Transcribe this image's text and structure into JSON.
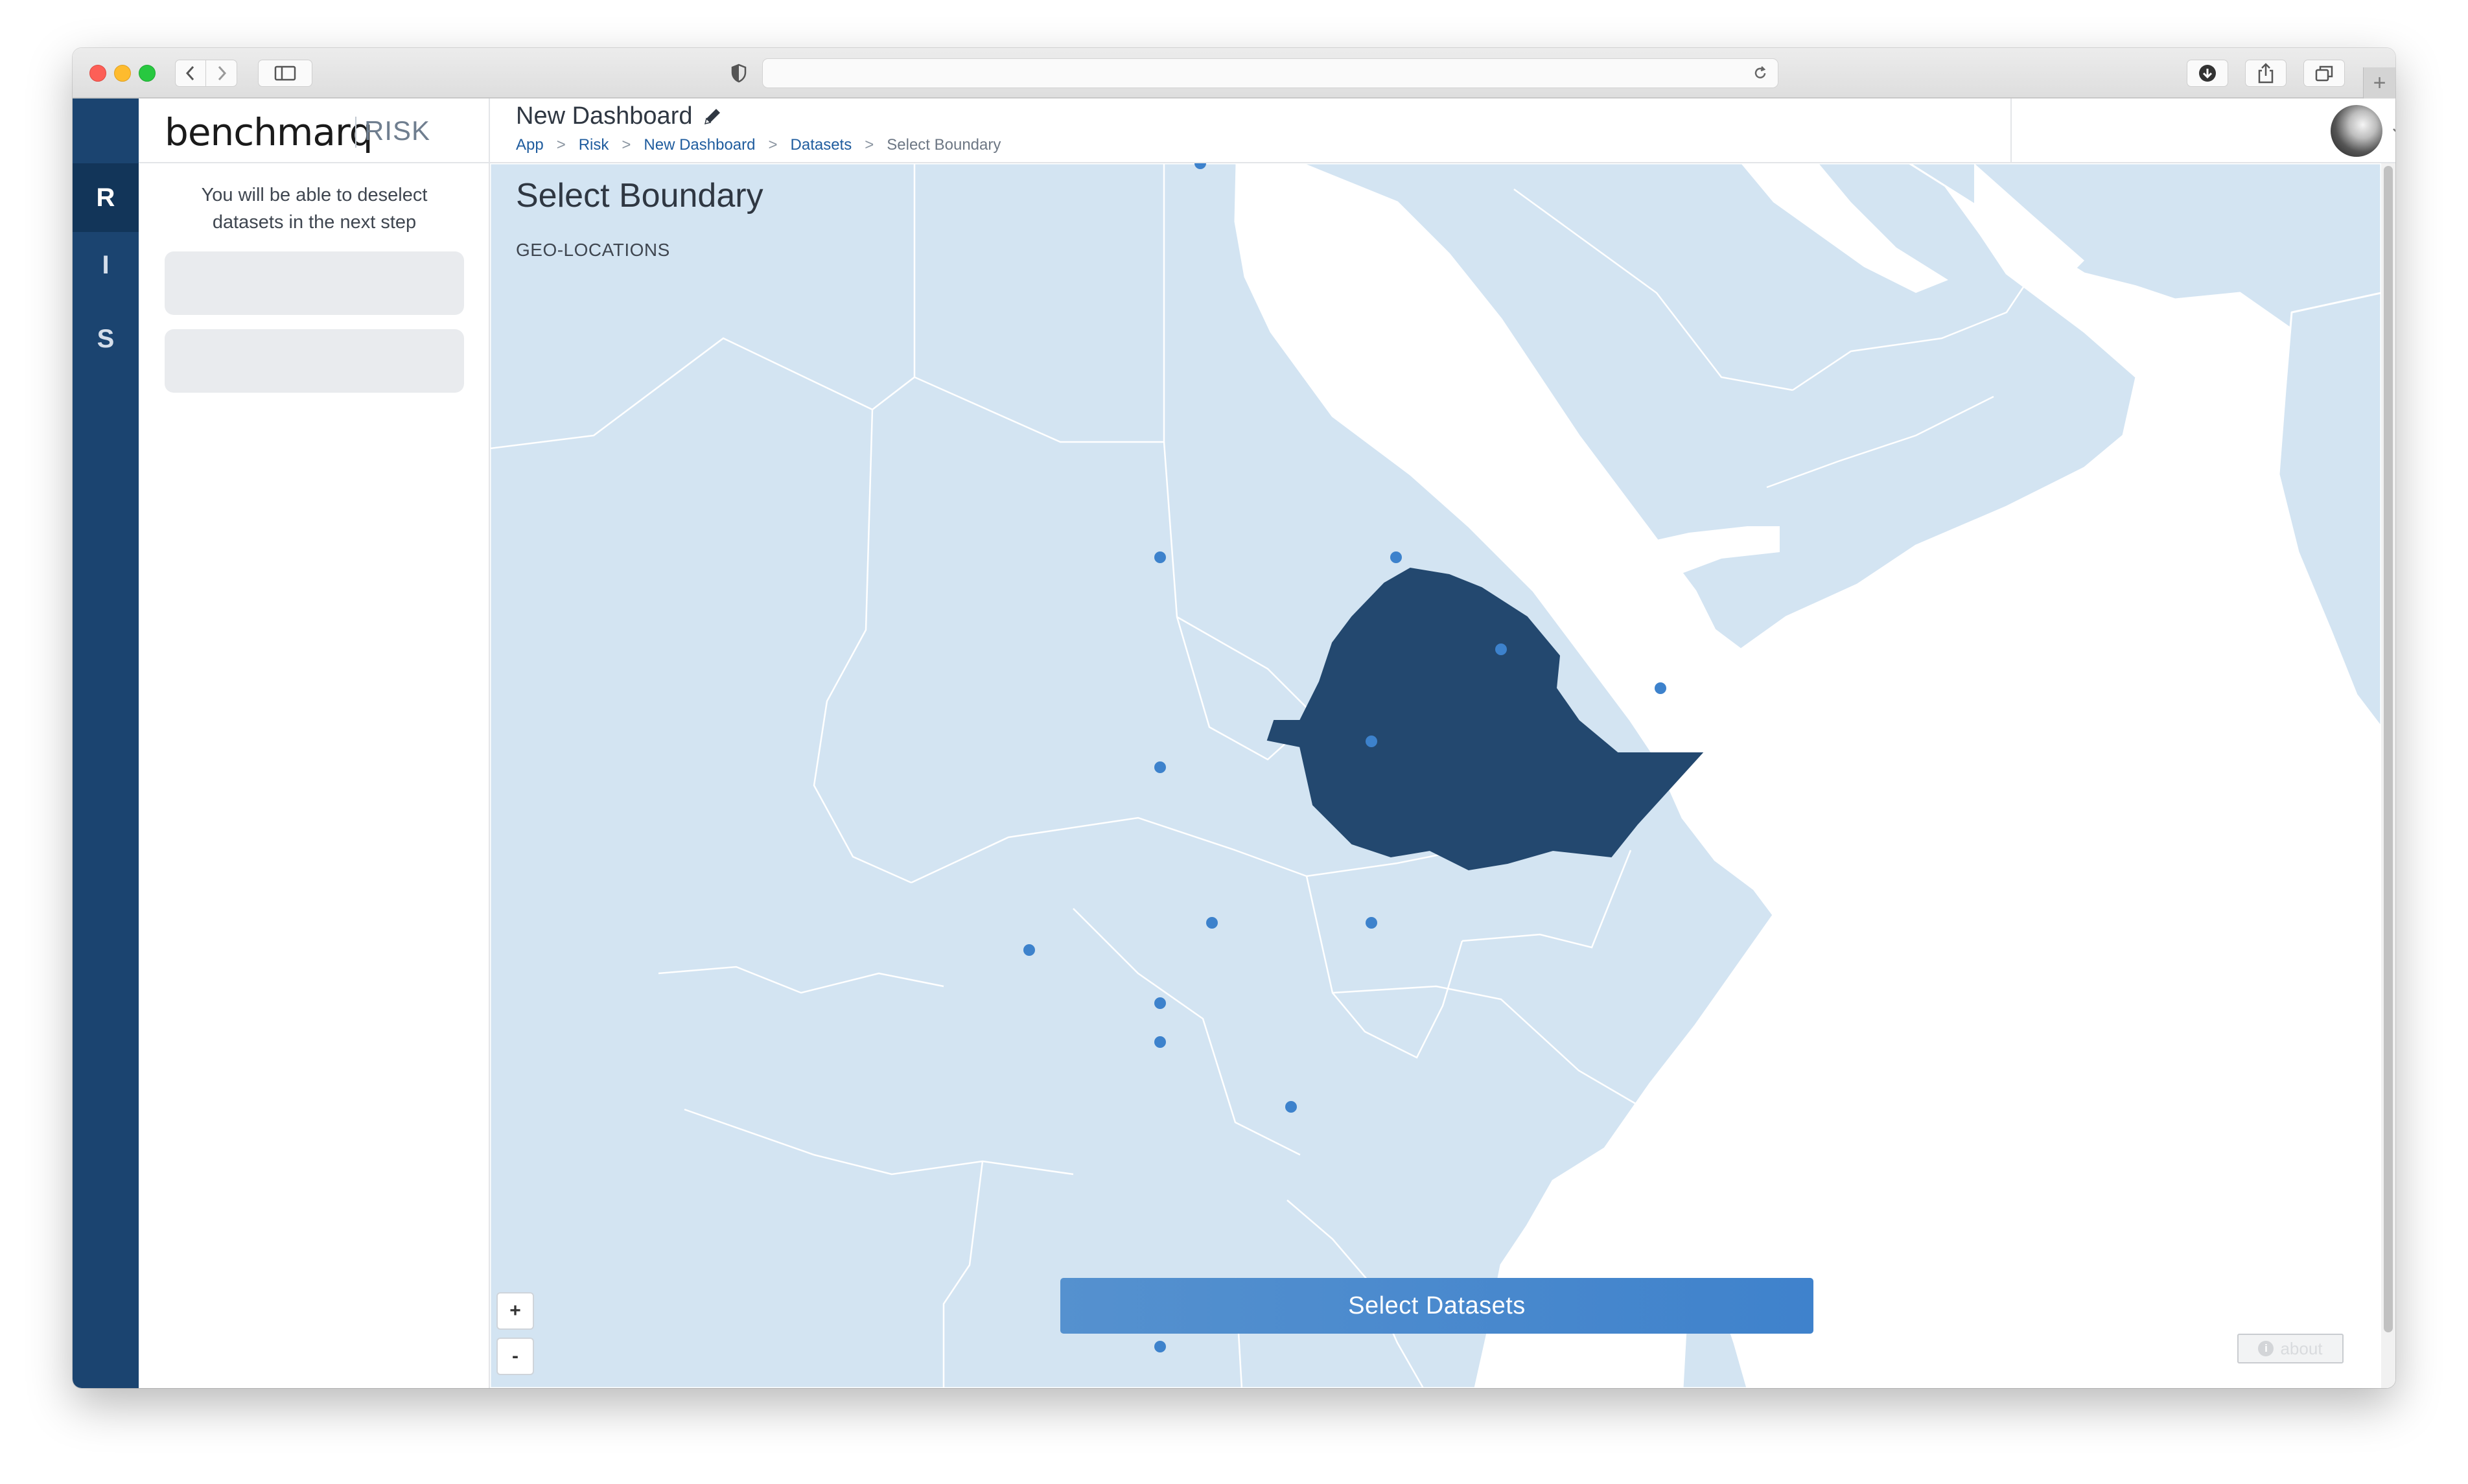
{
  "browser": {
    "address": "",
    "icons": [
      "back-icon",
      "forward-icon",
      "sidebar-icon",
      "shield-icon",
      "reload-icon",
      "download-icon",
      "share-icon",
      "tabs-icon",
      "plus-icon"
    ],
    "new_tab_glyph": "+"
  },
  "rail": {
    "items": [
      {
        "label": "R",
        "active": true
      },
      {
        "label": "I",
        "active": false
      },
      {
        "label": "S",
        "active": false
      }
    ]
  },
  "brand": {
    "name": "benchmarq",
    "product": "RISK"
  },
  "panel": {
    "hint": "You will be able to deselect datasets in the next step"
  },
  "header": {
    "title": "New Dashboard",
    "breadcrumb": [
      "App",
      "Risk",
      "New Dashboard",
      "Datasets",
      "Select Boundary"
    ],
    "separator": ">"
  },
  "map": {
    "title": "Select Boundary",
    "subtitle": "GEO-LOCATIONS",
    "zoom_in": "+",
    "zoom_out": "-",
    "selected_region": "Ethiopia",
    "selected_color": "#23486f",
    "land_color": "#d3e4f2",
    "marker_color": "#3d82cc"
  },
  "actions": {
    "select_datasets": "Select Datasets",
    "about": "about",
    "about_glyph": "i"
  }
}
